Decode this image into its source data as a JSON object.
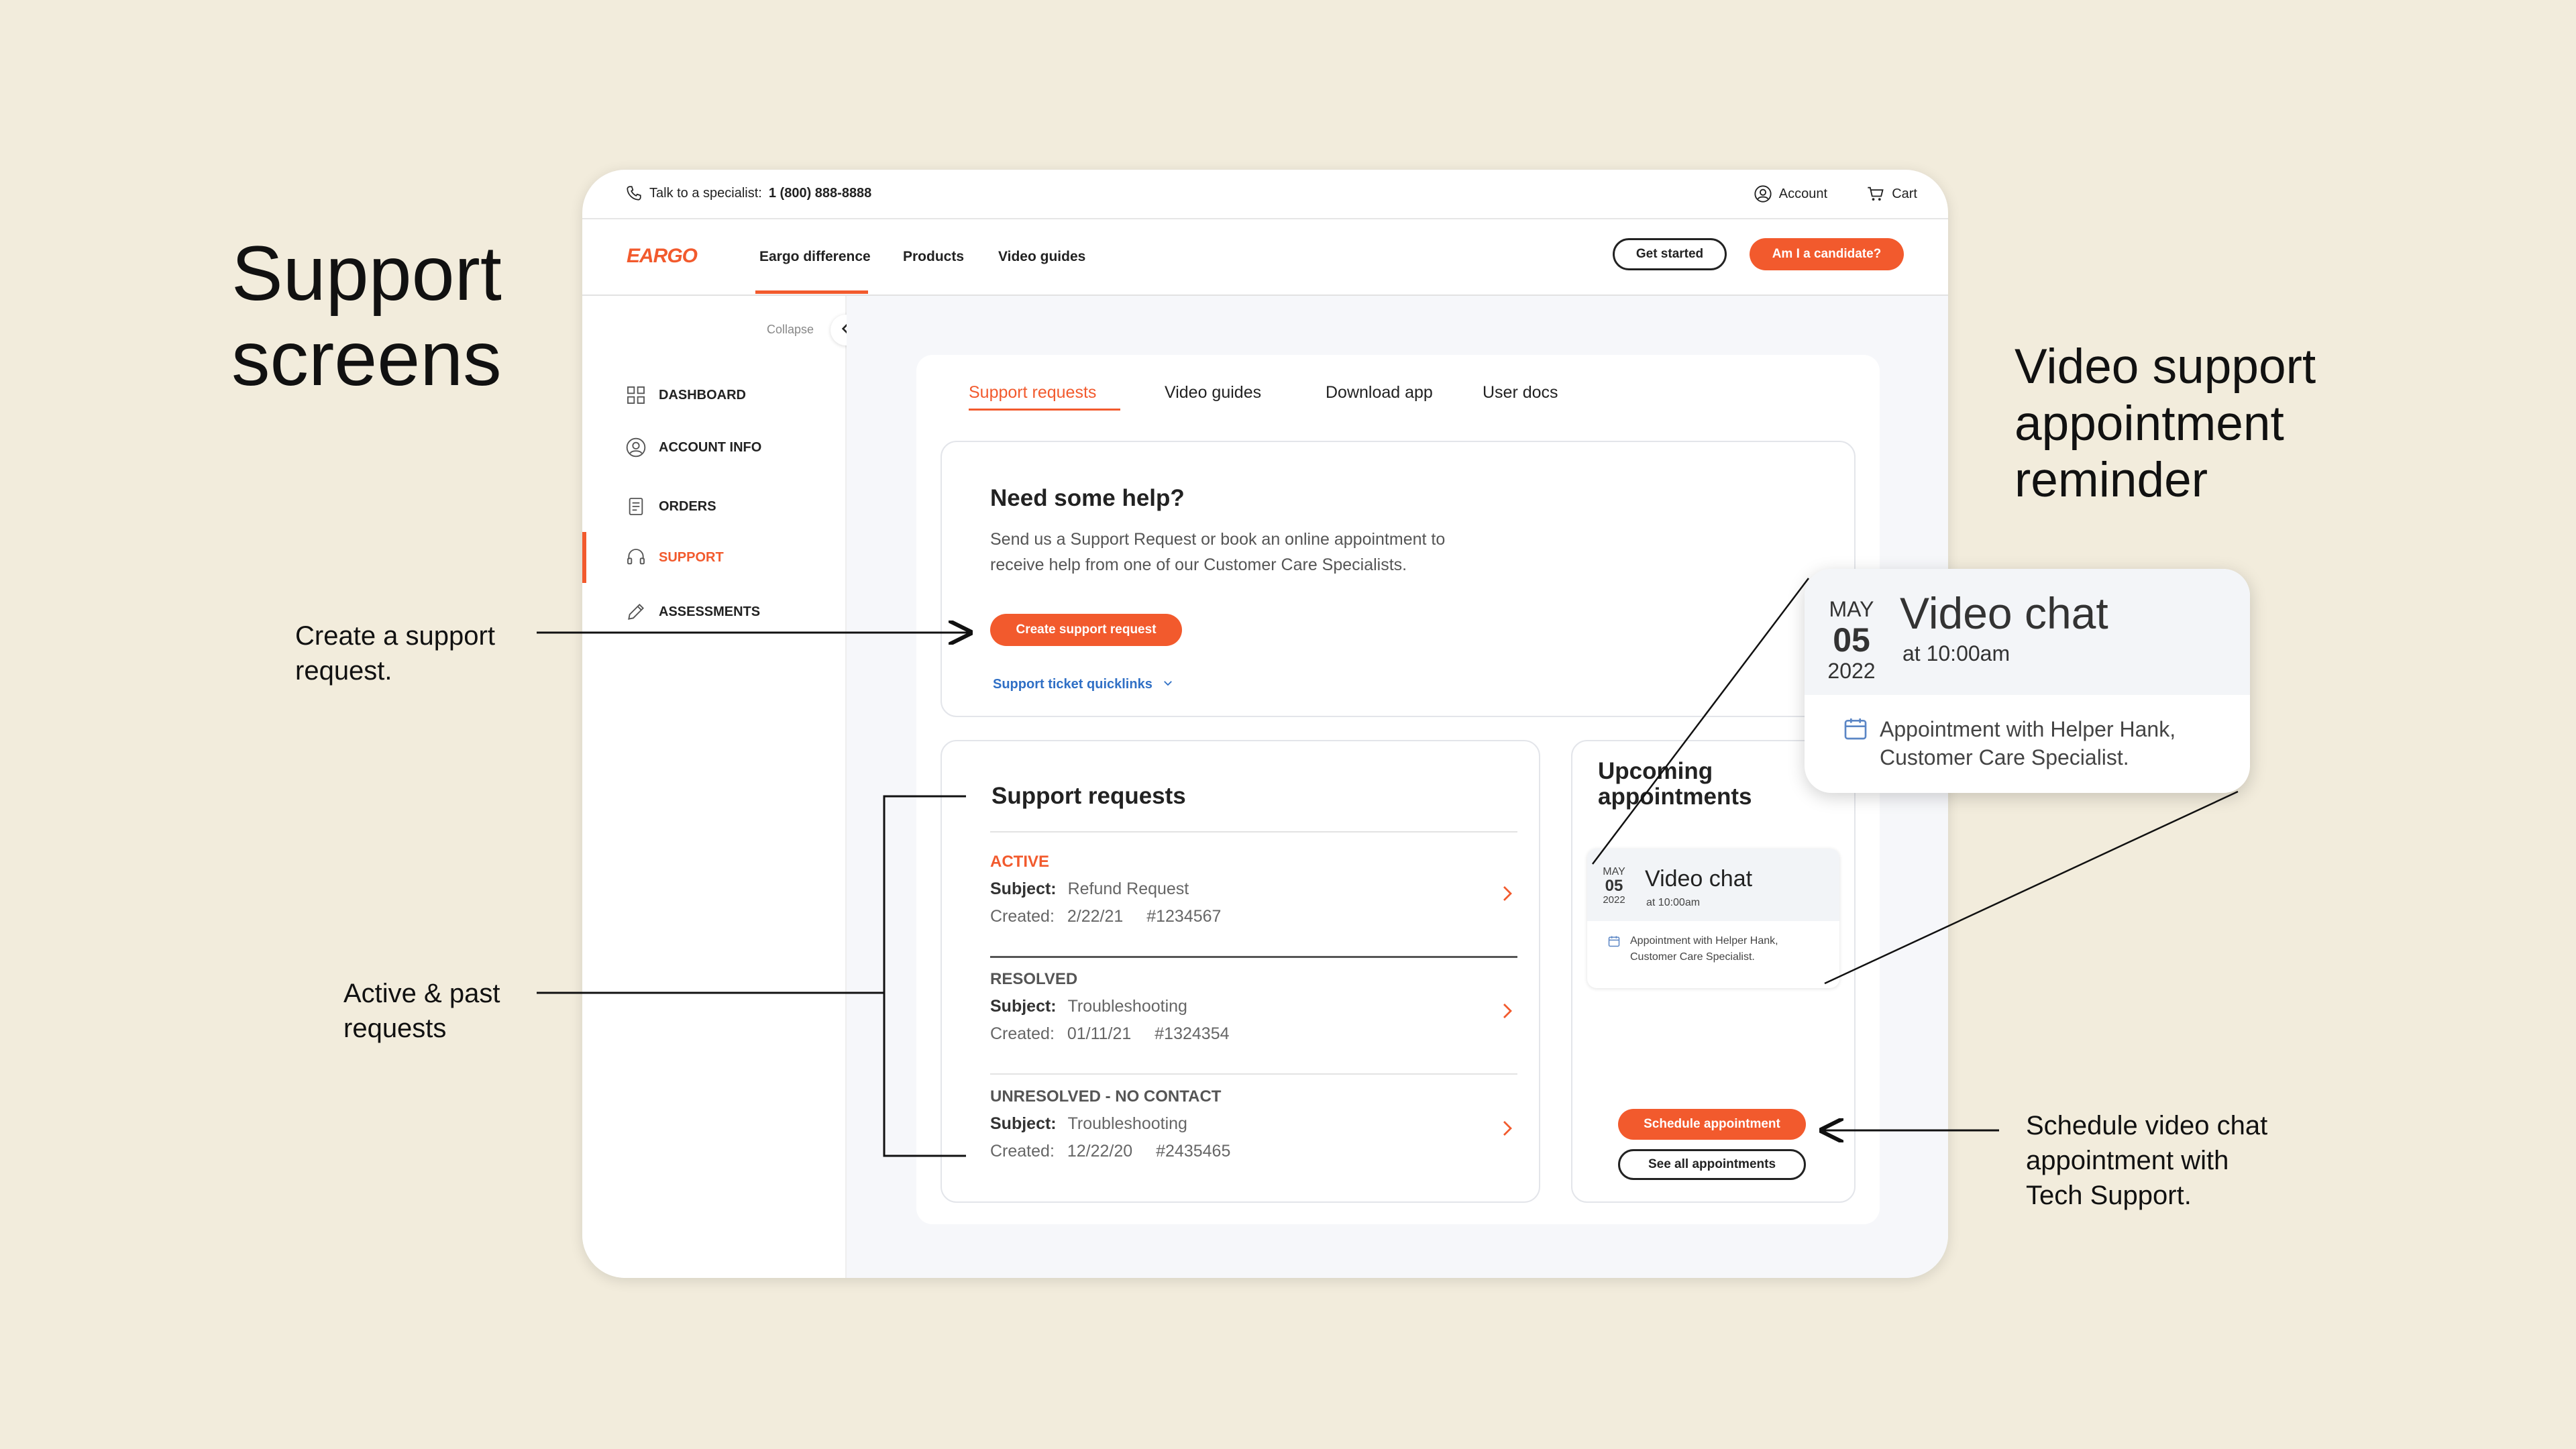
{
  "headline": "Support\nscreens",
  "annotations": {
    "create": "Create a support\nrequest.",
    "active_past": "Active & past\nrequests",
    "schedule": "Schedule video chat\nappointment with\nTech Support.",
    "video_reminder": "Video support\nappointment\nreminder"
  },
  "topbar": {
    "talk_label": "Talk to a specialist:",
    "phone": "1 (800) 888-8888",
    "account": "Account",
    "cart": "Cart"
  },
  "nav": {
    "logo": "EARGO",
    "links": [
      "Eargo difference",
      "Products",
      "Video guides"
    ],
    "get_started": "Get started",
    "candidate": "Am I a candidate?"
  },
  "sidebar": {
    "collapse": "Collapse",
    "items": [
      {
        "label": "DASHBOARD",
        "icon": "grid-icon"
      },
      {
        "label": "ACCOUNT INFO",
        "icon": "user-icon"
      },
      {
        "label": "ORDERS",
        "icon": "clipboard-icon"
      },
      {
        "label": "SUPPORT",
        "icon": "headset-icon",
        "active": true
      },
      {
        "label": "ASSESSMENTS",
        "icon": "pencil-icon"
      }
    ]
  },
  "tabs": [
    "Support requests",
    "Video guides",
    "Download app",
    "User docs"
  ],
  "help": {
    "title": "Need some help?",
    "body_line1": "Send us a Support Request or book an online appointment to",
    "body_line2": "receive help from one of our Customer Care Specialists.",
    "button": "Create support request",
    "quicklinks": "Support ticket quicklinks"
  },
  "requests": {
    "title": "Support requests",
    "subject_label": "Subject:",
    "created_label": "Created:",
    "items": [
      {
        "status": "ACTIVE",
        "subject": "Refund Request",
        "created": "2/22/21",
        "ticket": "#1234567"
      },
      {
        "status": "RESOLVED",
        "subject": "Troubleshooting",
        "created": "01/11/21",
        "ticket": "#1324354"
      },
      {
        "status": "UNRESOLVED - NO CONTACT",
        "subject": "Troubleshooting",
        "created": "12/22/20",
        "ticket": "#2435465"
      }
    ]
  },
  "appointments": {
    "title_line1": "Upcoming",
    "title_line2": "appointments",
    "month": "MAY",
    "day": "05",
    "year": "2022",
    "type": "Video chat",
    "time": "at 10:00am",
    "desc_line1": "Appointment with Helper Hank,",
    "desc_line2": "Customer Care Specialist.",
    "schedule_button": "Schedule appointment",
    "see_all_button": "See all appointments"
  },
  "colors": {
    "accent": "#f25a2d",
    "background": "#f2ecdc",
    "link": "#2f6fc5"
  }
}
